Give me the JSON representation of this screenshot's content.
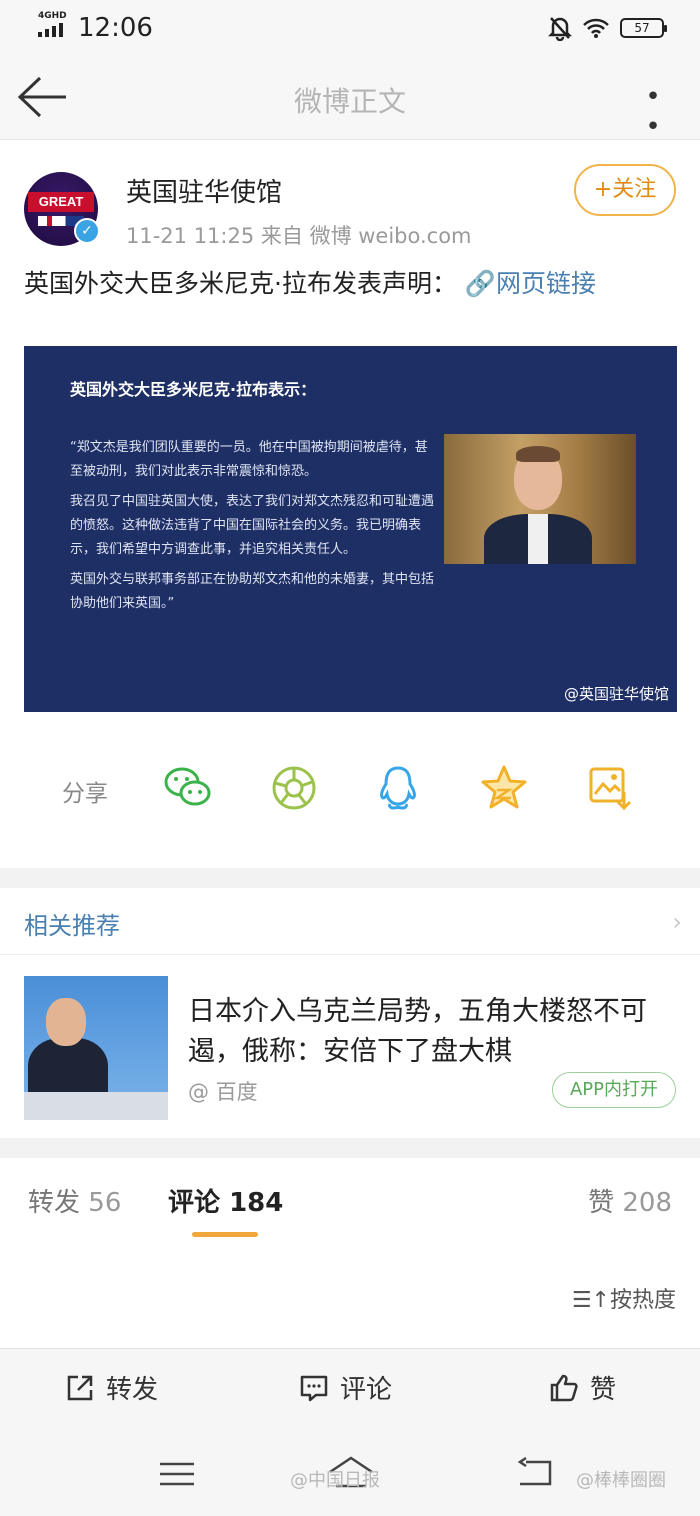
{
  "status_bar": {
    "network": "4GHD",
    "time": "12:06",
    "battery": "57"
  },
  "nav": {
    "title": "微博正文"
  },
  "post": {
    "author": "英国驻华使馆",
    "avatar_text": "GREAT",
    "meta": "11-21 11:25  来自 微博 weibo.com",
    "follow_label": "+关注",
    "text": "英国外交大臣多米尼克·拉布发表声明：",
    "link_label": "网页链接",
    "card": {
      "heading": "英国外交大臣多米尼克·拉布表示：",
      "quote": [
        "“郑文杰是我们团队重要的一员。他在中国被拘期间被虐待，甚至被动刑，我们对此表示非常震惊和惊恐。",
        "我召见了中国驻英国大使，表达了我们对郑文杰残忍和可耻遭遇的愤怒。这种做法违背了中国在国际社会的义务。我已明确表示，我们希望中方调查此事，并追究相关责任人。",
        "英国外交与联邦事务部正在协助郑文杰和他的未婚妻，其中包括协助他们来英国。”"
      ],
      "watermark": "@英国驻华使馆"
    },
    "share_label": "分享"
  },
  "recommend": {
    "header": "相关推荐",
    "title": "日本介入乌克兰局势，五角大楼怒不可遏，俄称：安倍下了盘大棋",
    "source": "@ 百度",
    "open_label": "APP内打开"
  },
  "tabs": {
    "repost_label": "转发",
    "repost_count": "56",
    "comment_label": "评论",
    "comment_count": "184",
    "like_label": "赞",
    "like_count": "208",
    "sort_label": "按热度"
  },
  "actions": {
    "repost": "转发",
    "comment": "评论",
    "like": "赞"
  },
  "watermarks": {
    "left": "@中国日报",
    "right": "@棒棒圈圈"
  },
  "colors": {
    "accent_orange": "#f3a63a",
    "link_blue": "#4a7fb0",
    "card_navy": "#1e2f66",
    "wechat_green": "#3bb34a"
  }
}
